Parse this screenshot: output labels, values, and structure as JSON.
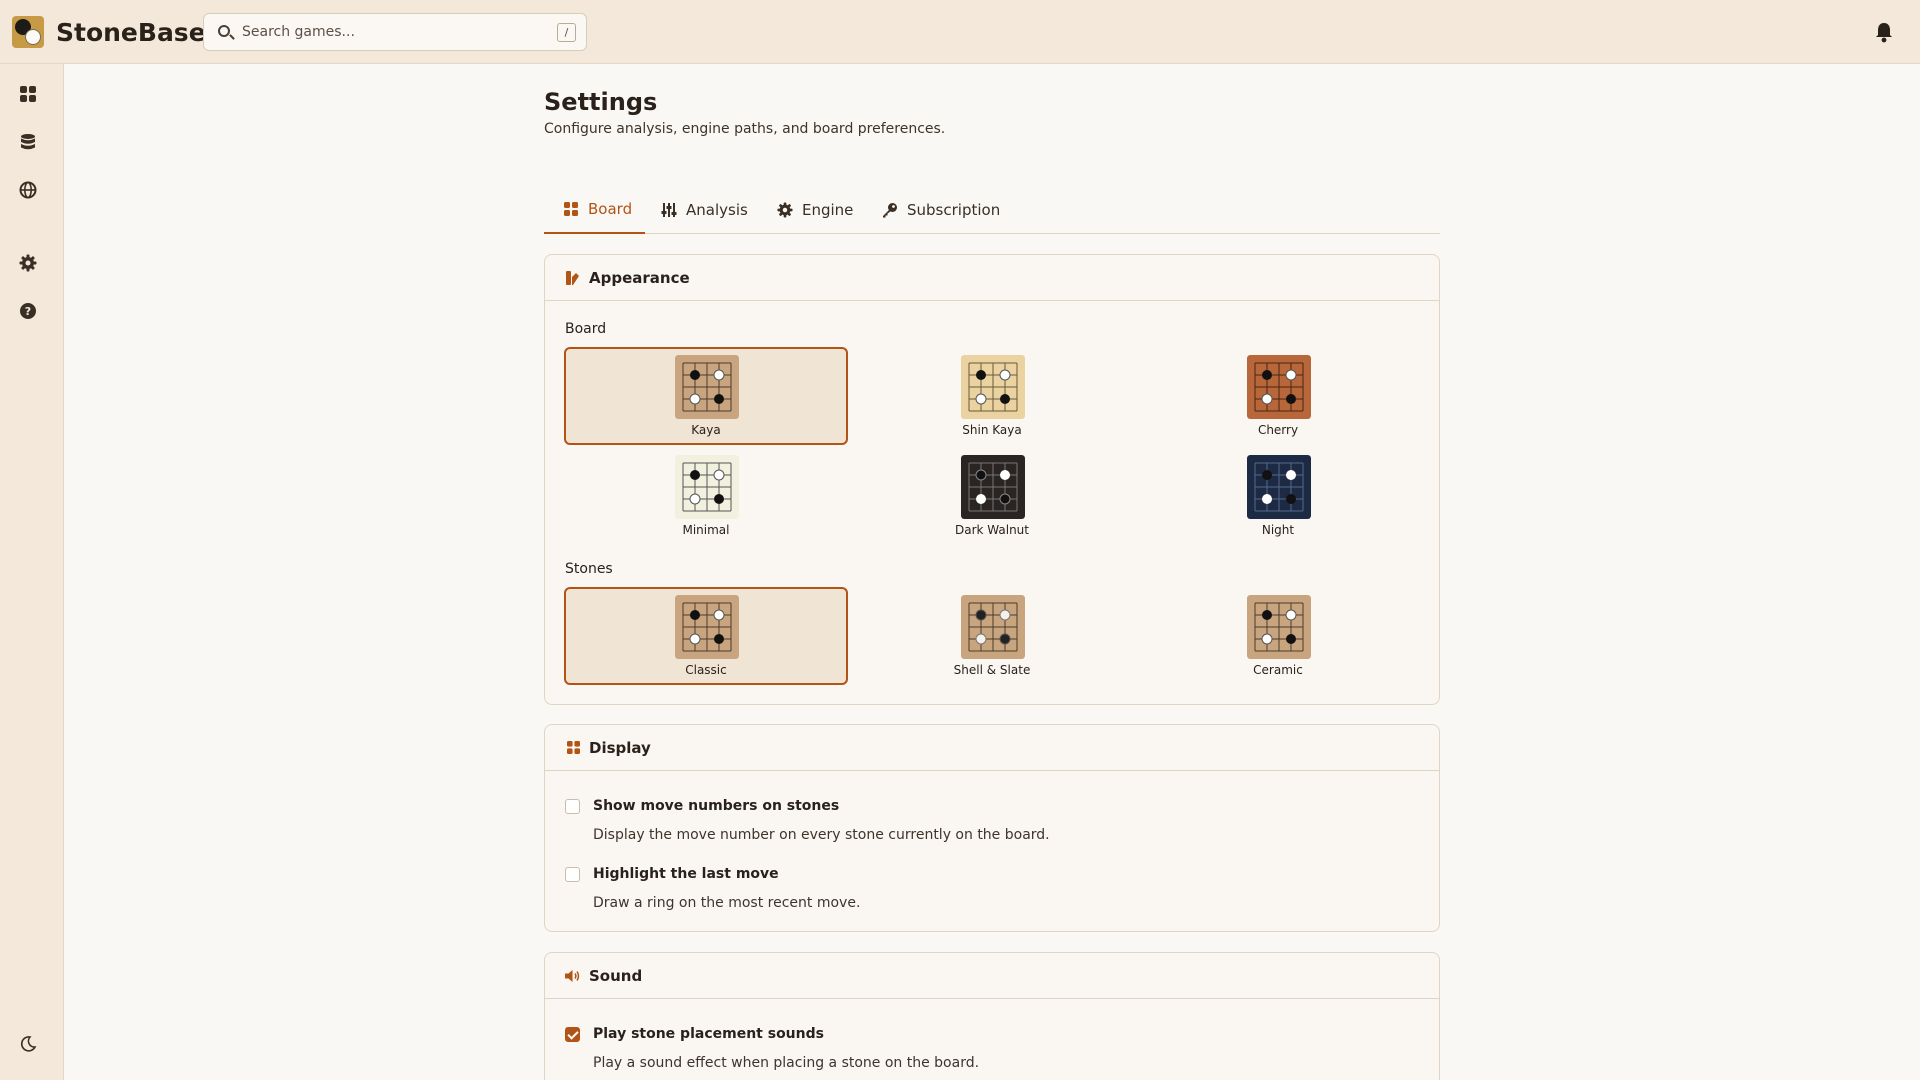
{
  "app": {
    "name": "StoneBase"
  },
  "search": {
    "placeholder": "Search games...",
    "shortcut": "/"
  },
  "sidebar": {
    "items": [
      {
        "icon": "dashboard-icon",
        "label": "Dashboard"
      },
      {
        "icon": "database-icon",
        "label": "Database"
      },
      {
        "icon": "globe-icon",
        "label": "Online"
      },
      {
        "icon": "gear-icon",
        "label": "Settings"
      },
      {
        "icon": "help-icon",
        "label": "Help"
      }
    ],
    "theme_icon": "moon-icon"
  },
  "page": {
    "title": "Settings",
    "subtitle": "Configure analysis, engine paths, and board preferences."
  },
  "tabs": [
    {
      "label": "Board",
      "icon": "grid-icon",
      "active": true
    },
    {
      "label": "Analysis",
      "icon": "sliders-icon",
      "active": false
    },
    {
      "label": "Engine",
      "icon": "gear-icon",
      "active": false
    },
    {
      "label": "Subscription",
      "icon": "key-icon",
      "active": false
    }
  ],
  "appearance": {
    "title": "Appearance",
    "board_label": "Board",
    "boards": [
      {
        "name": "Kaya",
        "selected": true,
        "bg": "#c9a57f",
        "line": "#4a3a2a"
      },
      {
        "name": "Shin Kaya",
        "selected": false,
        "bg": "#ead3a0",
        "line": "#6b5a3a"
      },
      {
        "name": "Cherry",
        "selected": false,
        "bg": "#b8673b",
        "line": "#4a2612"
      },
      {
        "name": "Minimal",
        "selected": false,
        "bg": "#f2f1df",
        "line": "#555555"
      },
      {
        "name": "Dark Walnut",
        "selected": false,
        "bg": "#2a2522",
        "line": "#777777"
      },
      {
        "name": "Night",
        "selected": false,
        "bg": "#1c2a44",
        "line": "#56688a"
      }
    ],
    "stones_label": "Stones",
    "stones": [
      {
        "name": "Classic",
        "selected": true
      },
      {
        "name": "Shell & Slate",
        "selected": false
      },
      {
        "name": "Ceramic",
        "selected": false
      }
    ]
  },
  "display": {
    "title": "Display",
    "options": [
      {
        "label": "Show move numbers on stones",
        "desc": "Display the move number on every stone currently on the board.",
        "checked": false
      },
      {
        "label": "Highlight the last move",
        "desc": "Draw a ring on the most recent move.",
        "checked": false
      }
    ]
  },
  "sound": {
    "title": "Sound",
    "options": [
      {
        "label": "Play stone placement sounds",
        "desc": "Play a sound effect when placing a stone on the board.",
        "checked": true
      }
    ]
  },
  "colors": {
    "accent": "#b25416",
    "topbar": "#f3e8d9",
    "background": "#faf8f4"
  }
}
